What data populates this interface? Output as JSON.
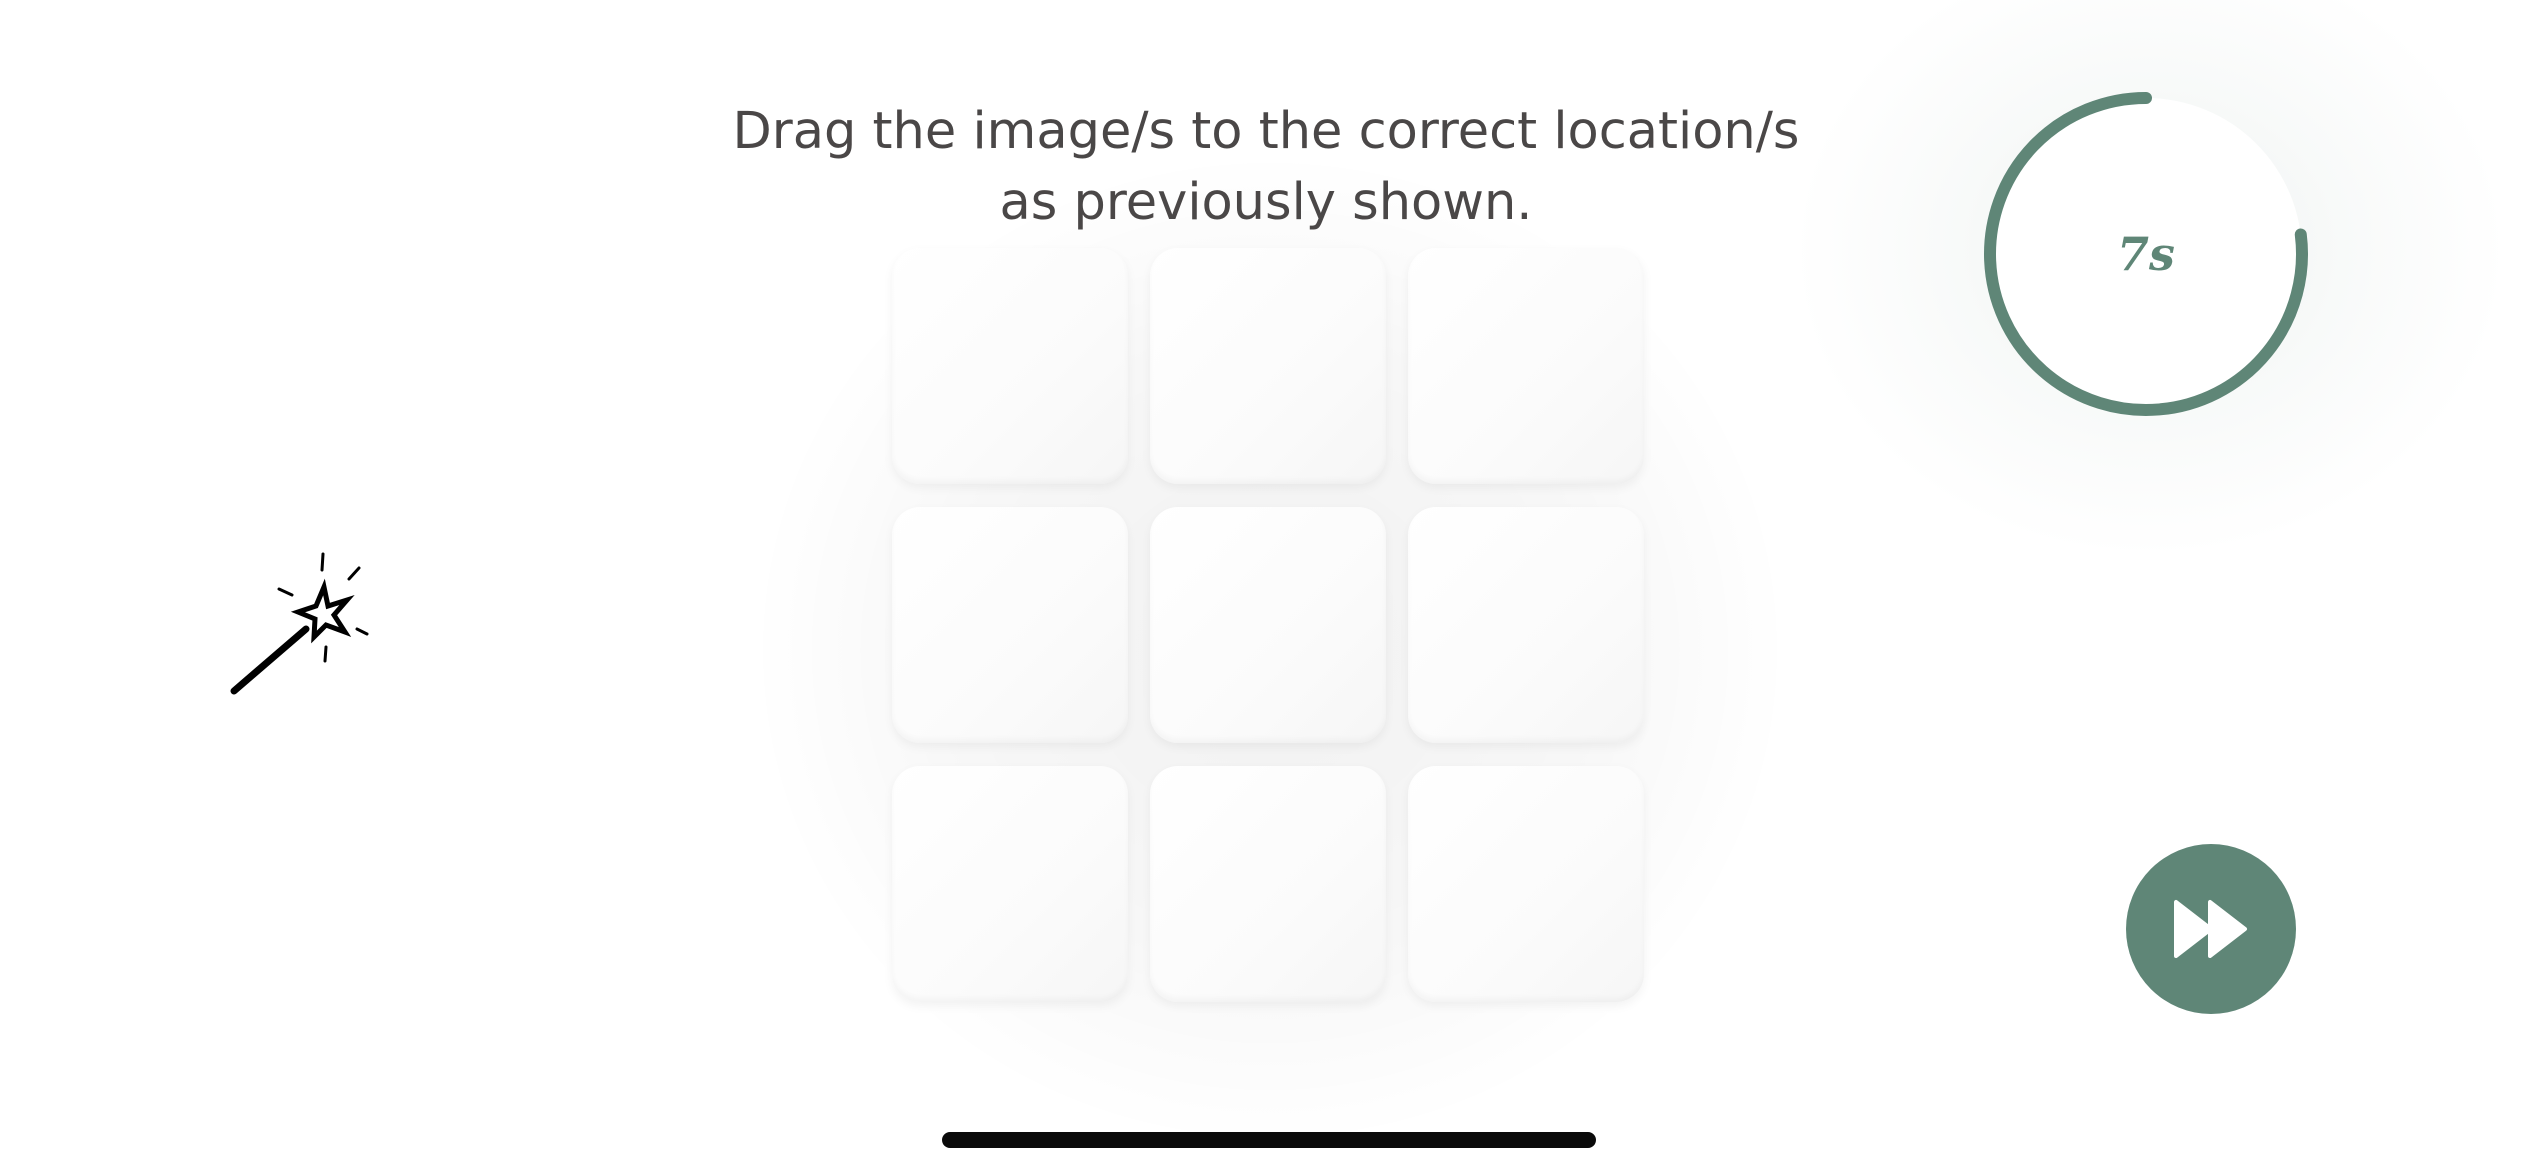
{
  "instruction": {
    "line1": "Drag the image/s to the correct location/s",
    "line2": "as previously shown."
  },
  "grid": {
    "rows": 3,
    "columns": 3,
    "cells": [
      {
        "row": 1,
        "col": 1,
        "content": ""
      },
      {
        "row": 1,
        "col": 2,
        "content": ""
      },
      {
        "row": 1,
        "col": 3,
        "content": ""
      },
      {
        "row": 2,
        "col": 1,
        "content": ""
      },
      {
        "row": 2,
        "col": 2,
        "content": ""
      },
      {
        "row": 2,
        "col": 3,
        "content": ""
      },
      {
        "row": 3,
        "col": 1,
        "content": ""
      },
      {
        "row": 3,
        "col": 2,
        "content": ""
      },
      {
        "row": 3,
        "col": 3,
        "content": ""
      }
    ]
  },
  "hint": {
    "icon": "magic-wand-icon"
  },
  "timer": {
    "label": "7s",
    "remaining_fraction": 0.77,
    "color": "#5f8677",
    "track_color": "#ffffff"
  },
  "skip_button": {
    "icon": "fast-forward-icon",
    "color": "#5f8677"
  },
  "colors": {
    "accent": "#5f8677",
    "text": "#4a4747",
    "background": "#ffffff",
    "cell": "#fdfdfd"
  }
}
